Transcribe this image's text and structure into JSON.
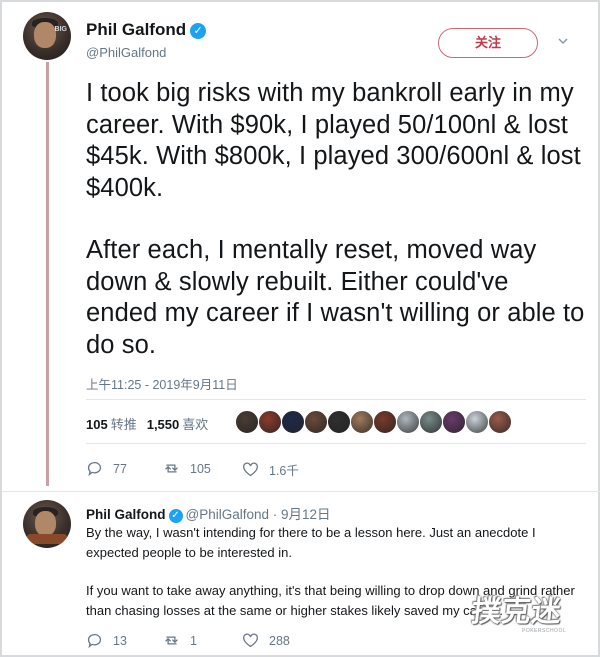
{
  "main_tweet": {
    "author_name": "Phil Galfond",
    "handle": "@PhilGalfond",
    "follow_label": "关注",
    "paragraphs": [
      "I took big risks with my bankroll early in my career. With $90k, I played 50/100nl & lost $45k. With $800k, I played 300/600nl & lost $400k.",
      "After each, I mentally reset, moved way down & slowly rebuilt. Either could've ended my career if I wasn't willing or able to do so."
    ],
    "timestamp": "上午11:25 - 2019年9月11日",
    "retweet_count": "105",
    "retweet_label": "转推",
    "like_count": "1,550",
    "like_label": "喜欢",
    "actions": {
      "replies": "77",
      "retweets": "105",
      "likes": "1.6千"
    }
  },
  "reply_tweet": {
    "author_name": "Phil Galfond",
    "meta": "@PhilGalfond · 9月12日",
    "paragraphs": [
      "By the way, I wasn't intending for there to be a lesson here. Just an anecdote I expected people to be interested in.",
      "If you want to take away anything, it's that being willing to drop down and grind rather than chasing losses at the same or higher stakes likely saved my career."
    ],
    "actions": {
      "replies": "13",
      "retweets": "1",
      "likes": "288"
    }
  },
  "watermark": {
    "text": "撲克迷",
    "sub": "POKERSCHOOL"
  },
  "colors": {
    "verified": "#1da1f2",
    "follow_border": "#c76a74",
    "thread_line": "#c9a0a8",
    "muted": "#657786"
  },
  "liker_avatar_colors": [
    "#4a3c33",
    "#8c3b2a",
    "#1e2a4a",
    "#6a4a3a",
    "#2f2f2f",
    "#a07a5a",
    "#7a3a2a",
    "#b0b8bf",
    "#7a8a8a",
    "#6a3a6a",
    "#cbd3da",
    "#9a5a4a"
  ]
}
